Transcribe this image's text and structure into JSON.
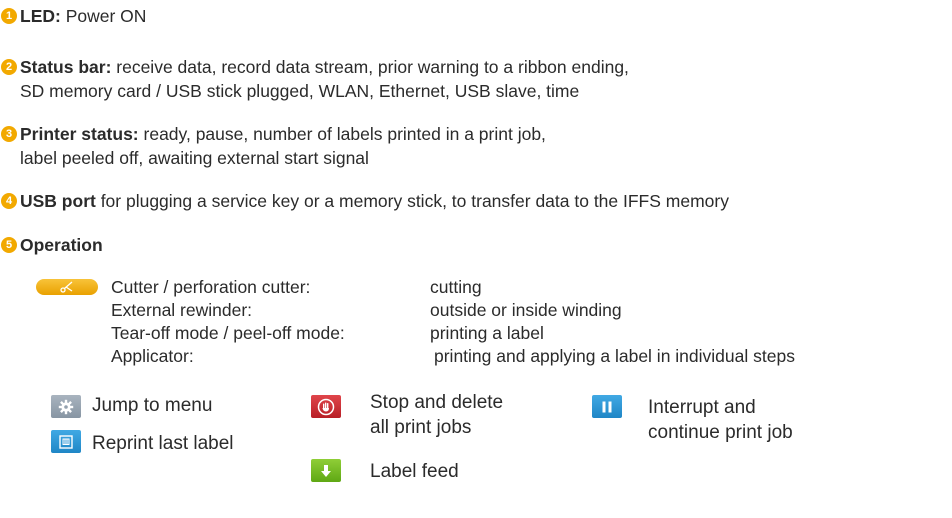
{
  "items": [
    {
      "num": "1",
      "title": "LED:",
      "text": " Power ON"
    },
    {
      "num": "2",
      "title": "Status bar:",
      "text": " receive data, record data stream, prior warning to a ribbon ending,",
      "text2": "SD memory card / USB stick plugged, WLAN, Ethernet, USB slave, time"
    },
    {
      "num": "3",
      "title": "Printer status:",
      "text": " ready, pause, number of labels printed in a print job,",
      "text2": "label peeled off, awaiting external start signal"
    },
    {
      "num": "4",
      "title": "USB port",
      "text": " for plugging a service key or a memory stick, to transfer data to the IFFS memory"
    },
    {
      "num": "5",
      "title": "Operation"
    }
  ],
  "operation_rows": [
    {
      "mode": "Cutter / perforation cutter:",
      "action": "cutting"
    },
    {
      "mode": "External rewinder:",
      "action": "outside or inside winding"
    },
    {
      "mode": "Tear-off mode / peel-off mode:",
      "action": "printing a label"
    },
    {
      "mode": "Applicator:",
      "action": "printing and applying a label in individual steps"
    }
  ],
  "buttons": {
    "menu": "Jump to menu",
    "reprint": "Reprint last label",
    "stop_line1": "Stop and delete",
    "stop_line2": "all print jobs",
    "feed": "Label feed",
    "pause_line1": "Interrupt and",
    "pause_line2": "continue print job"
  },
  "colors": {
    "number_badge": "#f2a900",
    "cutter_button": "#f2b21e",
    "menu_button": "#94a1ae",
    "reprint_button": "#2a93d6",
    "stop_button": "#c9272e",
    "feed_button": "#74b824",
    "pause_button": "#2a93d6"
  }
}
